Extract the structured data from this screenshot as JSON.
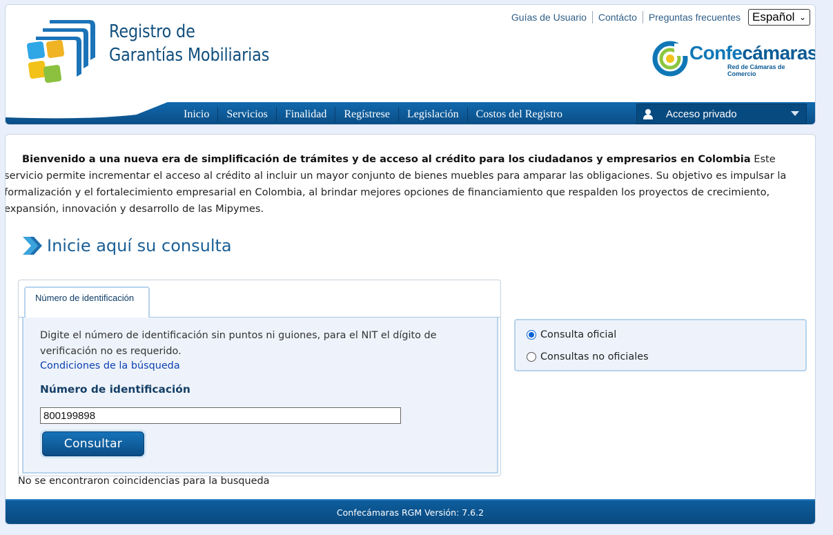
{
  "header": {
    "logo_title_line1": "Registro de",
    "logo_title_line2": "Garantías Mobiliarias",
    "top_links": [
      "Guías de Usuario",
      "Contácto",
      "Preguntas frecuentes"
    ],
    "language_selected": "Español",
    "partner_logo_text": "Confecámaras",
    "partner_logo_word_a": "Confe",
    "partner_logo_word_b": "cámaras",
    "partner_logo_subtitle": "Red de Cámaras de Comercio"
  },
  "nav": {
    "items": [
      "Inicio",
      "Servicios",
      "Finalidad",
      "Regístrese",
      "Legislación",
      "Costos del Registro"
    ],
    "private_access_label": "Acceso privado"
  },
  "main": {
    "intro_bold": "Bienvenido a una nueva era de simplificación de trámites y de acceso al crédito para los ciudadanos y empresarios en Colombia",
    "intro_rest": " Este servicio permite incrementar el acceso al crédito al incluir un mayor conjunto de bienes muebles para amparar las obligaciones. Su objetivo es impulsar la formalización y el fortalecimiento empresarial en Colombia, al brindar mejores opciones de financiamiento que respalden los proyectos de crecimiento, expansión, innovación y desarrollo de las Mipymes.",
    "section_title": "Inicie aquí su consulta",
    "search": {
      "tab_label": "Número de identificación",
      "instructions": "Digite el número de identificación sin puntos ni guiones, para el NIT el dígito de verificación no es requerido.",
      "conditions_link": "Condiciones de la búsqueda",
      "field_label": "Número de identificación",
      "field_value": "800199898",
      "submit_label": "Consultar"
    },
    "no_results": "No se encontraron coincidencias para la busqueda",
    "options": {
      "official_label": "Consulta oficial",
      "official_checked": true,
      "unofficial_label": "Consultas no oficiales",
      "unofficial_checked": false
    }
  },
  "footer": {
    "version_text": "Confecámaras RGM Versión: 7.6.2"
  },
  "colors": {
    "brand_blue": "#0a4a80",
    "title_blue": "#1b5f96",
    "page_bg": "#eaf0fb"
  }
}
